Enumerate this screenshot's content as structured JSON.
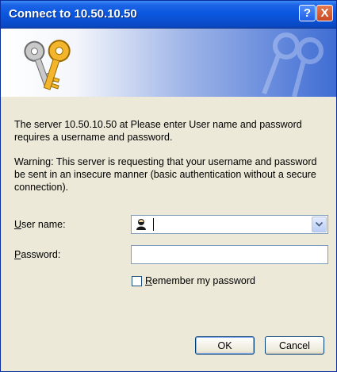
{
  "window": {
    "title": "Connect to 10.50.10.50",
    "help_button": "?",
    "close_button": "X"
  },
  "body": {
    "message": "The server 10.50.10.50 at Please enter User name and password requires a username and password.",
    "warning": "Warning: This server is requesting that your username and password be sent in an insecure manner (basic authentication without a secure connection)."
  },
  "form": {
    "username_label": "User name:",
    "username_value": "",
    "password_label": "Password:",
    "password_value": "",
    "remember_label": "Remember my password",
    "remember_checked": false
  },
  "buttons": {
    "ok": "OK",
    "cancel": "Cancel"
  },
  "icons": {
    "banner": "keys-icon",
    "user": "user-icon",
    "dropdown": "chevron-down-icon"
  }
}
